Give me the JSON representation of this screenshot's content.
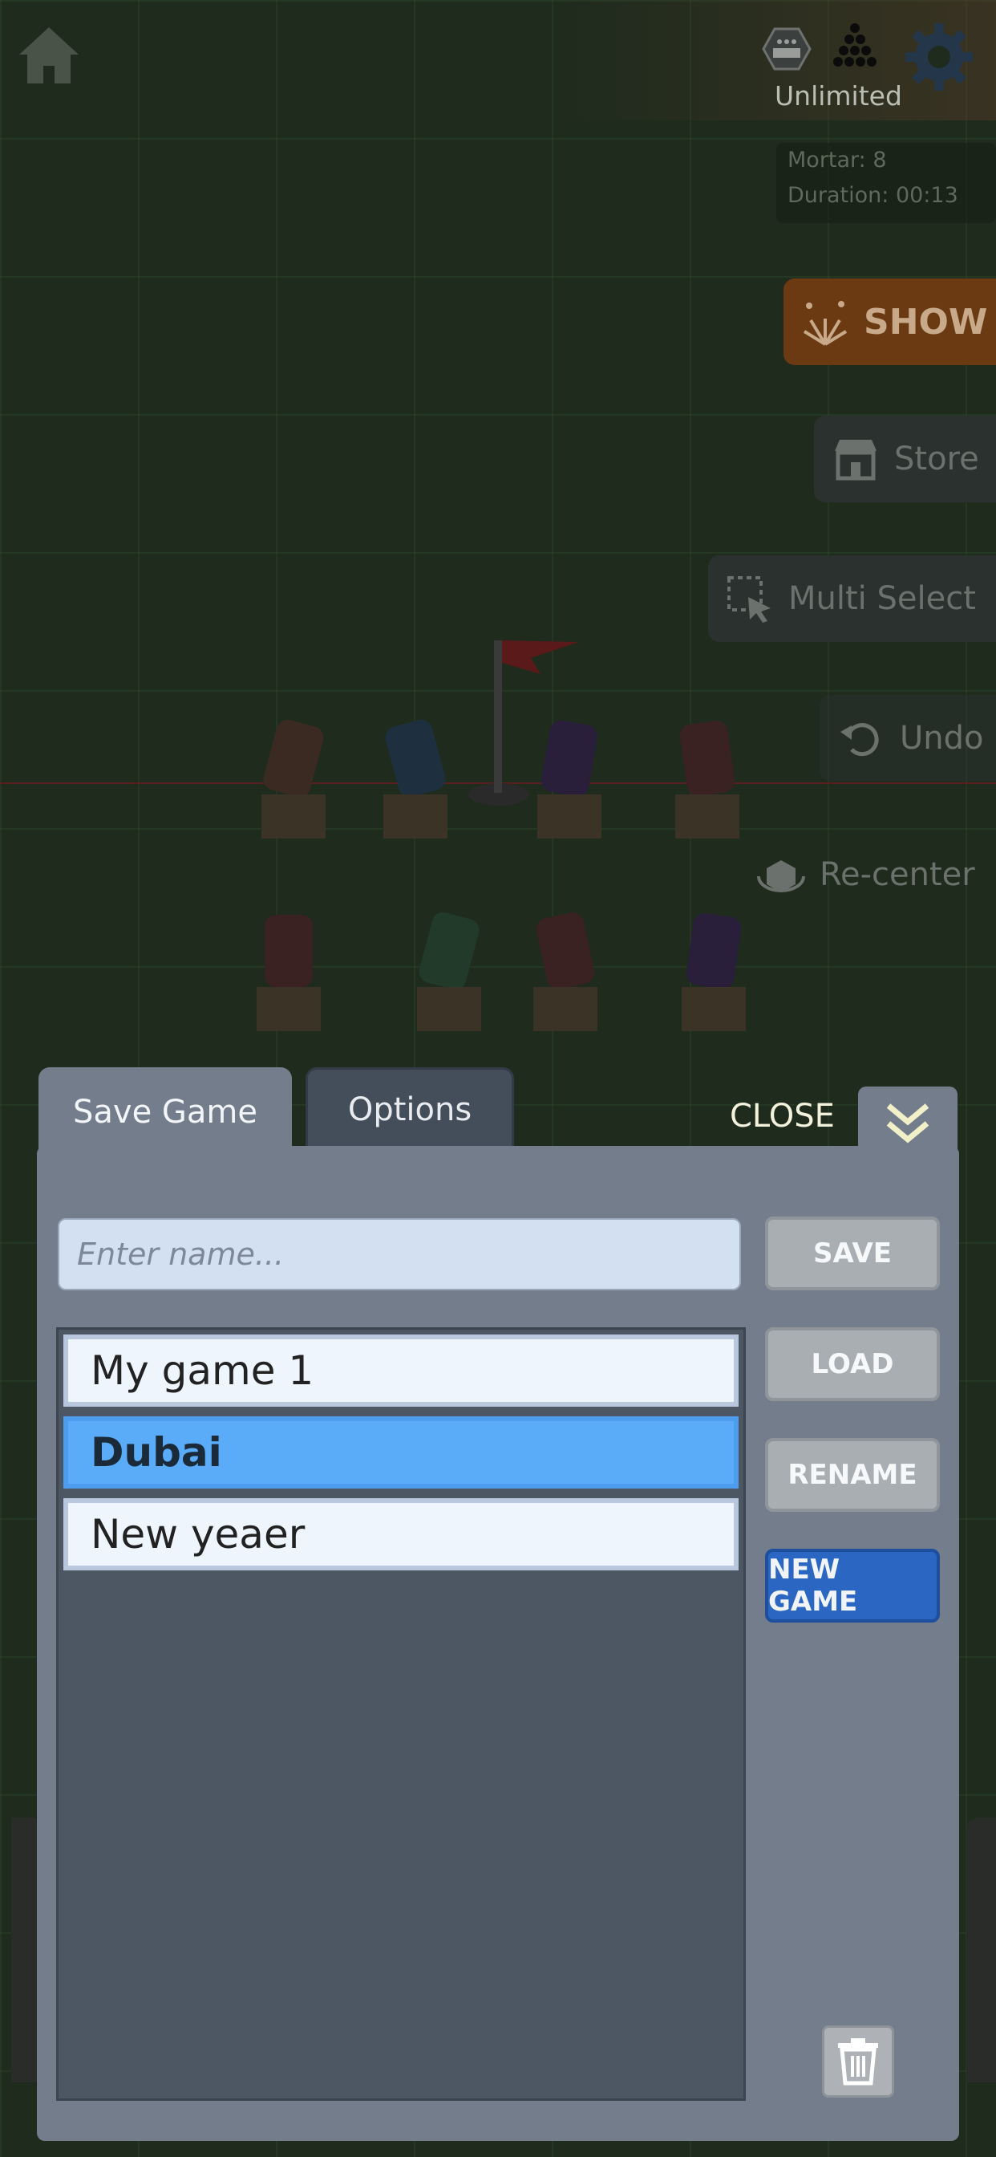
{
  "hud": {
    "currency_label": "Unlimited",
    "stats": {
      "mortar": "Mortar: 8",
      "duration": "Duration: 00:13"
    }
  },
  "side_menu": {
    "show_label": "SHOW",
    "store_label": "Store",
    "multi_select_label": "Multi Select",
    "undo_label": "Undo",
    "recenter_label": "Re-center"
  },
  "panel": {
    "tabs": [
      {
        "label": "Save Game",
        "active": true
      },
      {
        "label": "Options",
        "active": false
      }
    ],
    "close_label": "CLOSE",
    "name_input": {
      "placeholder": "Enter name...",
      "value": ""
    },
    "saves": [
      {
        "name": "My game 1",
        "selected": false
      },
      {
        "name": "Dubai",
        "selected": true
      },
      {
        "name": "New yeaer",
        "selected": false
      }
    ],
    "buttons": {
      "save": "SAVE",
      "load": "LOAD",
      "rename": "RENAME",
      "new_game": "NEW GAME"
    }
  },
  "colors": {
    "panel_bg": "#737d8c",
    "selected_item": "#5aacf8",
    "primary_button": "#2b66c2",
    "background_scene": "#1f2b1d"
  }
}
